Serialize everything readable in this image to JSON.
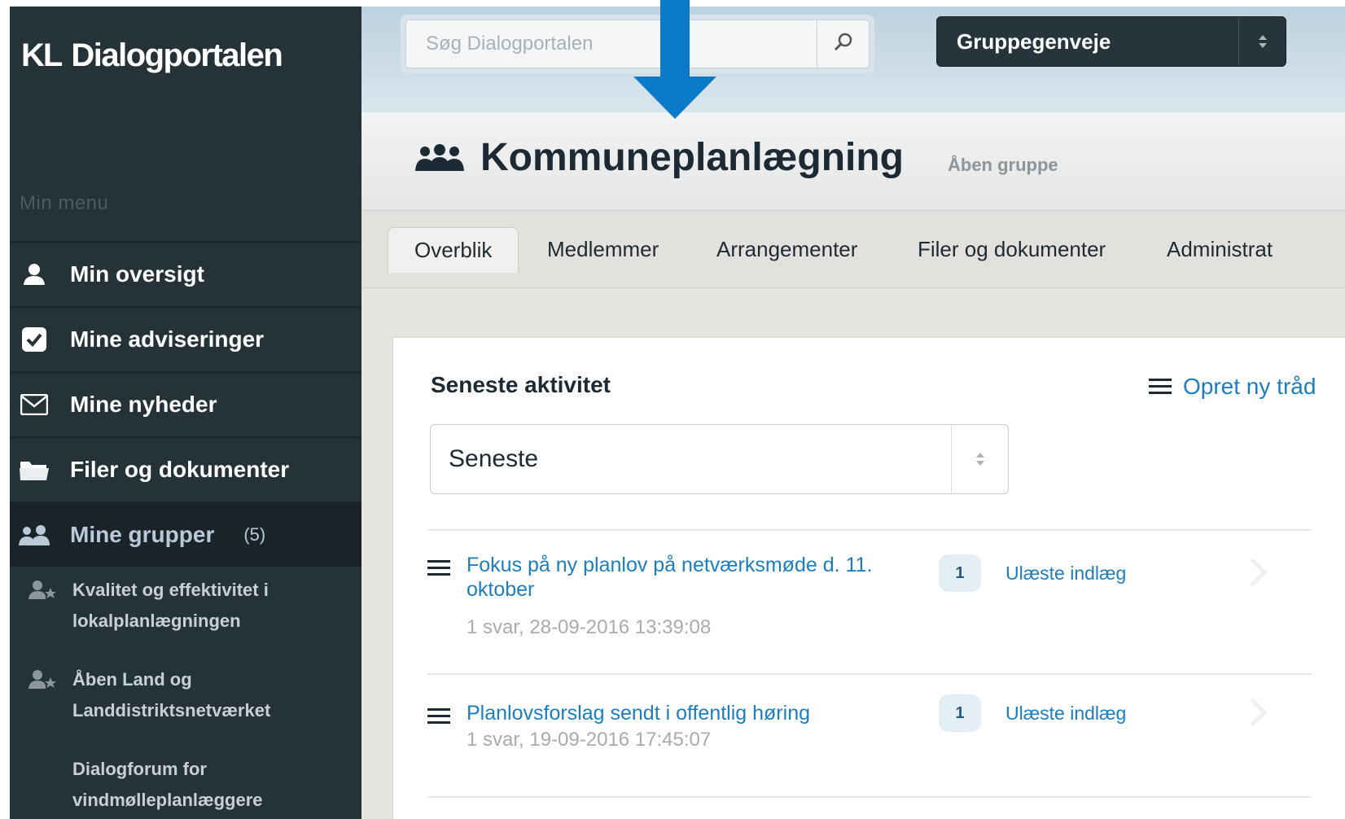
{
  "sidebar": {
    "logo_kl": "KL",
    "logo_name": "Dialogportalen",
    "menu_label": "Min menu",
    "items": [
      {
        "label": "Min oversigt",
        "icon": "user-icon"
      },
      {
        "label": "Mine adviseringer",
        "icon": "checkbox-icon"
      },
      {
        "label": "Mine nyheder",
        "icon": "envelope-icon"
      },
      {
        "label": "Filer og dokumenter",
        "icon": "folder-icon"
      },
      {
        "label": "Mine grupper",
        "count": "(5)",
        "icon": "group-icon",
        "active": true
      }
    ],
    "groups": [
      {
        "label": "Kvalitet og effektivitet i lokalplanlægningen",
        "icon": "group-star-icon"
      },
      {
        "label": "Åben Land og Landdistriktsnetværket",
        "icon": "group-star-icon"
      },
      {
        "label": "Dialogforum for vindmølleplanlæggere",
        "icon": "none"
      }
    ]
  },
  "topbar": {
    "search_placeholder": "Søg Dialogportalen",
    "shortcut_label": "Gruppegenveje"
  },
  "group": {
    "title": "Kommuneplanlægning",
    "type": "Åben gruppe"
  },
  "tabs": [
    {
      "label": "Overblik",
      "active": true
    },
    {
      "label": "Medlemmer"
    },
    {
      "label": "Arrangementer"
    },
    {
      "label": "Filer og dokumenter"
    },
    {
      "label": "Administrat"
    }
  ],
  "activity": {
    "title": "Seneste aktivitet",
    "new_thread_label": "Opret ny tråd",
    "sort_value": "Seneste",
    "threads": [
      {
        "title": "Fokus på ny planlov på netværksmøde d. 11. oktober",
        "meta": "1 svar, 28-09-2016 13:39:08",
        "unread_count": "1",
        "unread_label": "Ulæste indlæg"
      },
      {
        "title": "Planlovsforslag sendt i offentlig høring",
        "meta": "1 svar, 19-09-2016 17:45:07",
        "unread_count": "1",
        "unread_label": "Ulæste indlæg"
      }
    ]
  },
  "colors": {
    "sidebar_bg": "#253238",
    "link_blue": "#1b7fbf",
    "arrow_blue": "#0b7ac8"
  }
}
